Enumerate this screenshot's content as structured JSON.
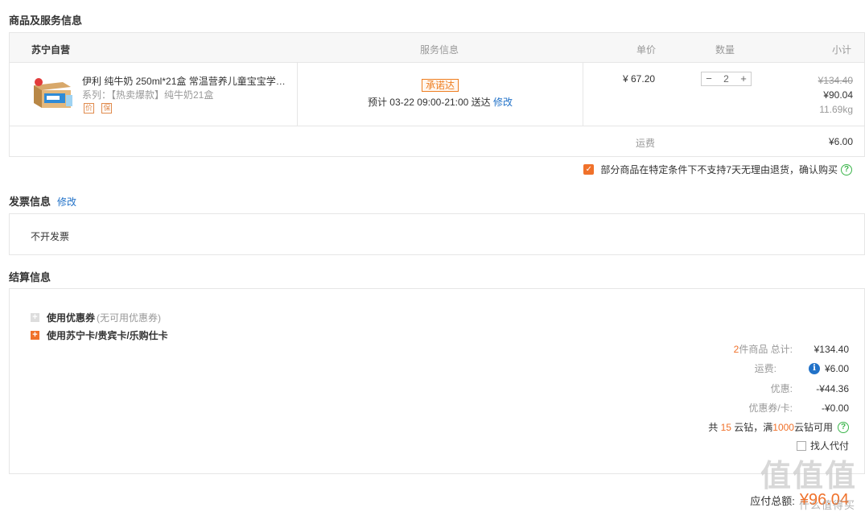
{
  "goods_section": {
    "title": "商品及服务信息"
  },
  "table_head": {
    "shop": "苏宁自营",
    "service": "服务信息",
    "unit_price": "单价",
    "quantity": "数量",
    "subtotal": "小计"
  },
  "item": {
    "name": "伊利 纯牛奶 250ml*21盒 常温营养儿童宝宝学…",
    "series": "系列：【热卖爆款】纯牛奶21盒",
    "tags": [
      "价",
      "保"
    ],
    "promise_badge": "承诺达",
    "eta": "预计 03-22  09:00-21:00 送达",
    "eta_modify": "修改",
    "unit_price": "¥ 67.20",
    "qty": "2",
    "qty_minus": "−",
    "qty_plus": "+",
    "original_subtotal": "¥134.40",
    "subtotal": "¥90.04",
    "weight": "11.69kg"
  },
  "shipping_row": {
    "label": "运费",
    "value": "¥6.00"
  },
  "agreement": {
    "text": "部分商品在特定条件下不支持7天无理由退货，确认购买",
    "checked": true
  },
  "invoice_section": {
    "title": "发票信息",
    "modify": "修改",
    "value": "不开发票"
  },
  "payment_section": {
    "title": "结算信息",
    "coupon_label": "使用优惠券",
    "coupon_note": "(无可用优惠券)",
    "card_label": "使用苏宁卡/贵宾卡/乐购仕卡"
  },
  "summary": {
    "count": "2",
    "count_suffix": "件商品 总计:",
    "total": "¥134.40",
    "shipping_label": "运费:",
    "shipping": "¥6.00",
    "discount_label": "优惠:",
    "discount": "-¥44.36",
    "coupon_label": "优惠券/卡:",
    "coupon": "-¥0.00",
    "cloud_prefix": "共",
    "cloud_count": "15",
    "cloud_mid": "云钻，满",
    "cloud_threshold": "1000",
    "cloud_suffix": "云钻可用",
    "proxy_pay": "找人代付",
    "payable_label": "应付总额:",
    "payable": "¥96.04"
  },
  "watermark": {
    "big": "值值值",
    "small": "什么值得买"
  },
  "colors": {
    "accent": "#f0712a",
    "link": "#2272c8",
    "help": "#3ab54a"
  },
  "icons": [
    "check-icon",
    "help-icon",
    "plus-icon",
    "info-icon",
    "product-thumbnail"
  ]
}
